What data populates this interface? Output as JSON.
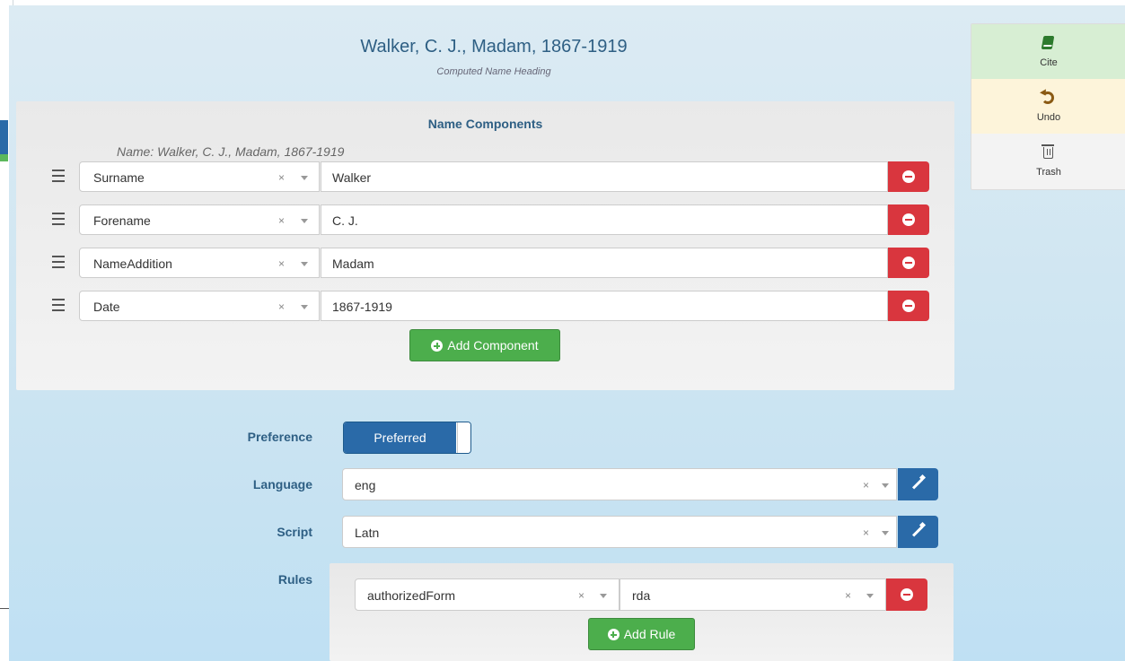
{
  "heading": {
    "title": "Walker, C. J., Madam, 1867-1919",
    "subtitle": "Computed Name Heading"
  },
  "name_components": {
    "title": "Name Components",
    "name_line": "Name: Walker, C. J., Madam, 1867-1919",
    "rows": [
      {
        "type": "Surname",
        "value": "Walker"
      },
      {
        "type": "Forename",
        "value": "C. J."
      },
      {
        "type": "NameAddition",
        "value": "Madam"
      },
      {
        "type": "Date",
        "value": "1867-1919"
      }
    ],
    "clear_symbol": "×",
    "add_button": "Add Component"
  },
  "form": {
    "preference_label": "Preference",
    "preference_value": "Preferred",
    "language_label": "Language",
    "language_value": "eng",
    "script_label": "Script",
    "script_value": "Latn",
    "rules_label": "Rules",
    "rule_type": "authorizedForm",
    "rule_value": "rda",
    "add_rule_button": "Add Rule"
  },
  "sidebar": {
    "cite": "Cite",
    "undo": "Undo",
    "trash": "Trash"
  },
  "colors": {
    "remove_red": "#d9363e",
    "add_green": "#4cae4c",
    "primary_blue": "#2a6aa8",
    "cite_bg": "#d7eed3",
    "undo_bg": "#fdf4da"
  },
  "icons": [
    "drag-handle-icon",
    "clear-icon",
    "chevron-down-icon",
    "minus-circle-icon",
    "plus-circle-icon",
    "magic-wand-icon",
    "book-icon",
    "undo-icon",
    "trash-icon"
  ]
}
